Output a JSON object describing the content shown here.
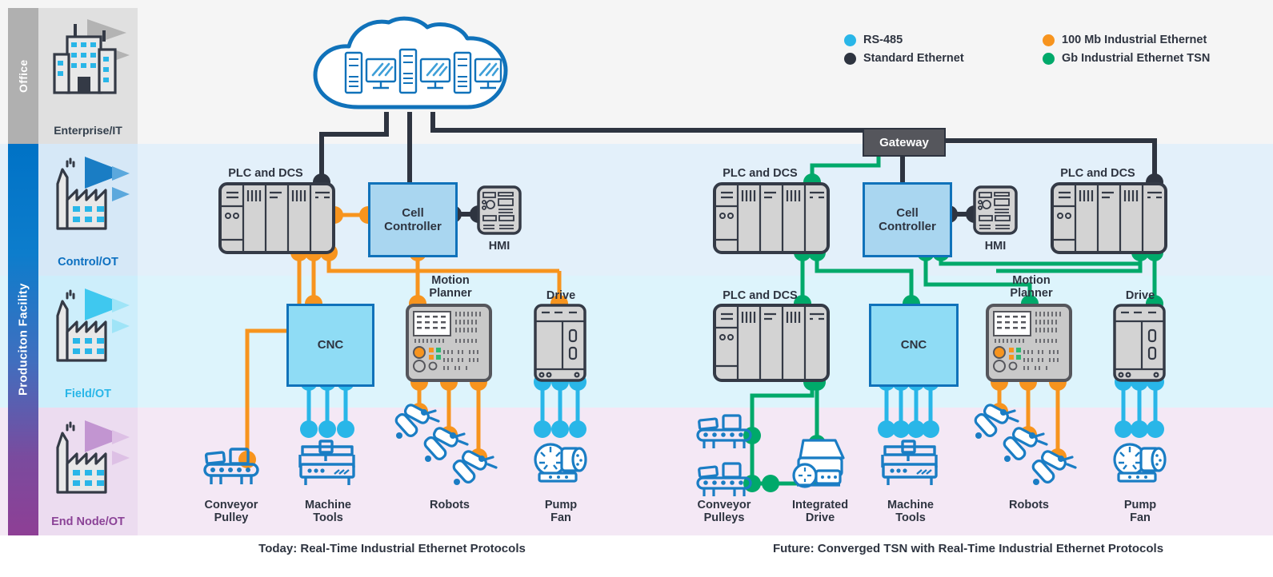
{
  "colors": {
    "rs485": "#29b6e8",
    "standard_ethernet": "#2e3440",
    "ethernet_100mb": "#f7941e",
    "tsn_gb": "#00a96a",
    "blue_outline": "#1072ba",
    "cnc_fill": "#8fdcf5",
    "cell_fill": "#a9d6f0",
    "gateway_fill": "#55565c"
  },
  "rails": {
    "office": "Office",
    "production": "Produciton Facility"
  },
  "tiers": [
    {
      "name": "Enterprise/IT",
      "icon": "office-building-icon"
    },
    {
      "name": "Control/OT",
      "icon": "factory-icon"
    },
    {
      "name": "Field/OT",
      "icon": "factory-icon"
    },
    {
      "name": "End Node/OT",
      "icon": "factory-icon"
    }
  ],
  "legend": {
    "items": [
      {
        "label": "RS-485",
        "color": "#29b6e8"
      },
      {
        "label": "100 Mb Industrial Ethernet",
        "color": "#f7941e"
      },
      {
        "label": "Standard Ethernet",
        "color": "#2e3440"
      },
      {
        "label": "Gb Industrial Ethernet TSN",
        "color": "#00a96a"
      }
    ]
  },
  "cloud": {
    "name": "cloud-datacenter-icon",
    "servers": 3
  },
  "gateway": {
    "label": "Gateway"
  },
  "left": {
    "caption": "Today: Real-Time Industrial Ethernet Protocols",
    "plc": {
      "label": "PLC and DCS"
    },
    "cell_controller": {
      "label": "Cell\nController",
      "line1": "Cell",
      "line2": "Controller"
    },
    "hmi": {
      "label": "HMI"
    },
    "cnc": {
      "label": "CNC"
    },
    "motion_planner": {
      "label": "Motion\nPlanner",
      "line1": "Motion",
      "line2": "Planner"
    },
    "drive": {
      "label": "Drive"
    },
    "end_nodes": [
      {
        "label": "Conveyor\nPulley",
        "line1": "Conveyor",
        "line2": "Pulley",
        "icon": "conveyor-icon"
      },
      {
        "label": "Machine\nTools",
        "line1": "Machine",
        "line2": "Tools",
        "icon": "machine-tool-icon"
      },
      {
        "label": "Robots",
        "line1": "Robots",
        "line2": "",
        "icon": "robot-arm-icon"
      },
      {
        "label": "Pump\nFan",
        "line1": "Pump",
        "line2": "Fan",
        "icon": "pump-fan-icon"
      }
    ]
  },
  "right": {
    "caption": "Future: Converged TSN with Real-Time Industrial Ethernet Protocols",
    "plc_left": {
      "label": "PLC and DCS"
    },
    "plc_right": {
      "label": "PLC and DCS"
    },
    "plc_mid": {
      "label": "PLC and DCS"
    },
    "cell_controller": {
      "line1": "Cell",
      "line2": "Controller"
    },
    "hmi": {
      "label": "HMI"
    },
    "cnc": {
      "label": "CNC"
    },
    "motion_planner": {
      "line1": "Motion",
      "line2": "Planner"
    },
    "drive": {
      "label": "Drive"
    },
    "end_nodes": [
      {
        "line1": "Conveyor",
        "line2": "Pulleys",
        "icon": "conveyor-icon"
      },
      {
        "line1": "Integrated",
        "line2": "Drive",
        "icon": "integrated-drive-icon"
      },
      {
        "line1": "Machine",
        "line2": "Tools",
        "icon": "machine-tool-icon"
      },
      {
        "line1": "Robots",
        "line2": "",
        "icon": "robot-arm-icon"
      },
      {
        "line1": "Pump",
        "line2": "Fan",
        "icon": "pump-fan-icon"
      }
    ]
  }
}
